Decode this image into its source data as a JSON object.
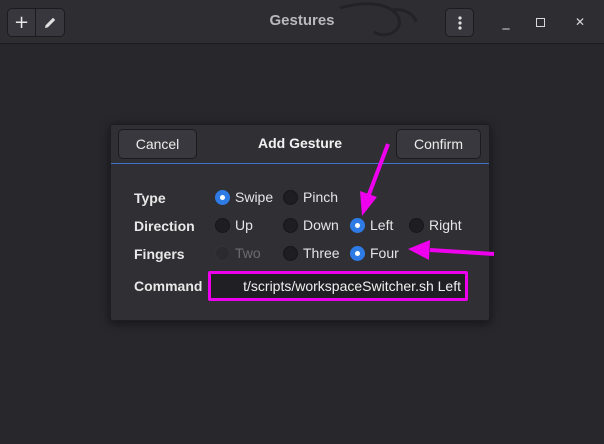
{
  "window": {
    "title": "Gestures"
  },
  "headerbar": {
    "add_icon": "plus-icon",
    "edit_icon": "pencil-icon",
    "menu_icon": "kebab-menu-icon",
    "minimize_icon": "minimize-icon",
    "maximize_icon": "maximize-icon",
    "close_icon": "close-icon",
    "glyphs": {
      "add": "+",
      "minimize": "_",
      "close": "✕"
    }
  },
  "dialog": {
    "title": "Add Gesture",
    "cancel_label": "Cancel",
    "confirm_label": "Confirm",
    "rows": {
      "type": {
        "label": "Type",
        "options": [
          "Swipe",
          "Pinch"
        ],
        "selected": "Swipe"
      },
      "direction": {
        "label": "Direction",
        "options": [
          "Up",
          "Down",
          "Left",
          "Right"
        ],
        "selected": "Left"
      },
      "fingers": {
        "label": "Fingers",
        "options": [
          "Two",
          "Three",
          "Four"
        ],
        "selected": "Four",
        "disabled": [
          "Two"
        ]
      },
      "command": {
        "label": "Command",
        "value": "t/scripts/workspaceSwitcher.sh Left"
      }
    }
  },
  "colors": {
    "accent": "#2f7be6",
    "annotation": "#ee00ee",
    "background": "#27272c"
  }
}
